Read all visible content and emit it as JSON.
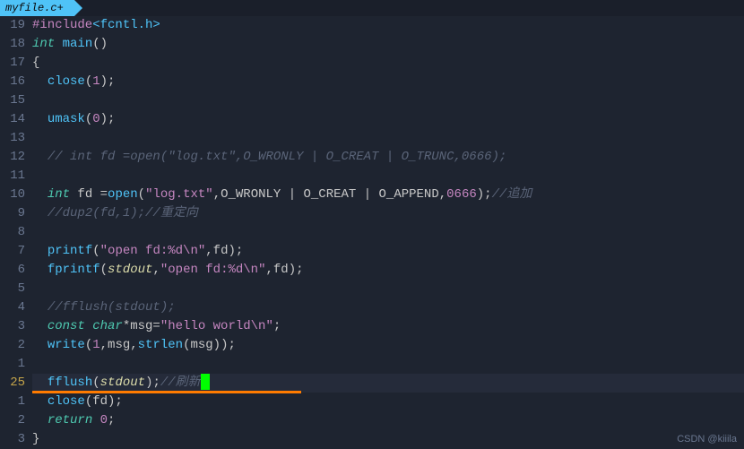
{
  "tab": {
    "filename": "myfile.c+"
  },
  "gutter_numbers": [
    "19",
    "18",
    "17",
    "16",
    "15",
    "14",
    "13",
    "12",
    "11",
    "10",
    "9",
    "8",
    "7",
    "6",
    "5",
    "4",
    "3",
    "2",
    "1",
    "25",
    "1",
    "2",
    "3"
  ],
  "current_line_index": 19,
  "code": {
    "l0": {
      "pp": "#include",
      "inc": "<fcntl.h>"
    },
    "l1": {
      "kw": "int",
      "fn": "main",
      "rest": "()"
    },
    "l2": {
      "text": "{"
    },
    "l3": {
      "fn": "close",
      "args": "(",
      "num": "1",
      "close": ");"
    },
    "l4": {
      "text": ""
    },
    "l5": {
      "fn": "umask",
      "args": "(",
      "num": "0",
      "close": ");"
    },
    "l6": {
      "text": ""
    },
    "l7": {
      "comment": "// int fd =open(\"log.txt\",O_WRONLY | O_CREAT | O_TRUNC,0666);"
    },
    "l8": {
      "text": ""
    },
    "l9": {
      "kw": "int",
      "sp": " fd =",
      "fn": "open",
      "open": "(",
      "str": "\"log.txt\"",
      "mid": ",O_WRONLY | O_CREAT | O_APPEND,",
      "num": "0666",
      "close": ");",
      "comment": "//追加"
    },
    "l10": {
      "comment": "//dup2(fd,1);//重定向"
    },
    "l11": {
      "text": ""
    },
    "l12": {
      "fn": "printf",
      "open": "(",
      "str": "\"open fd:%d\\n\"",
      "mid": ",fd);",
      "close": ""
    },
    "l13": {
      "fn": "fprintf",
      "open": "(",
      "id": "stdout",
      "mid": ",",
      "str": "\"open fd:%d\\n\"",
      "rest": ",fd);"
    },
    "l14": {
      "text": ""
    },
    "l15": {
      "comment": "//fflush(stdout);"
    },
    "l16": {
      "kw": "const char",
      "rest": "*msg=",
      "str": "\"hello world\\n\"",
      "close": ";"
    },
    "l17": {
      "fn": "write",
      "open": "(",
      "num": "1",
      "mid": ",msg,",
      "fn2": "strlen",
      "rest": "(msg));"
    },
    "l18": {
      "text": ""
    },
    "l19": {
      "fn": "fflush",
      "open": "(",
      "id": "stdout",
      "close": ");",
      "comment": "//刷新"
    },
    "l20": {
      "fn": "close",
      "rest": "(fd);"
    },
    "l21": {
      "kw": "return",
      "sp": " ",
      "num": "0",
      "close": ";"
    },
    "l22": {
      "text": "}"
    }
  },
  "underline_width": 300,
  "watermark": "CSDN @kiiila"
}
